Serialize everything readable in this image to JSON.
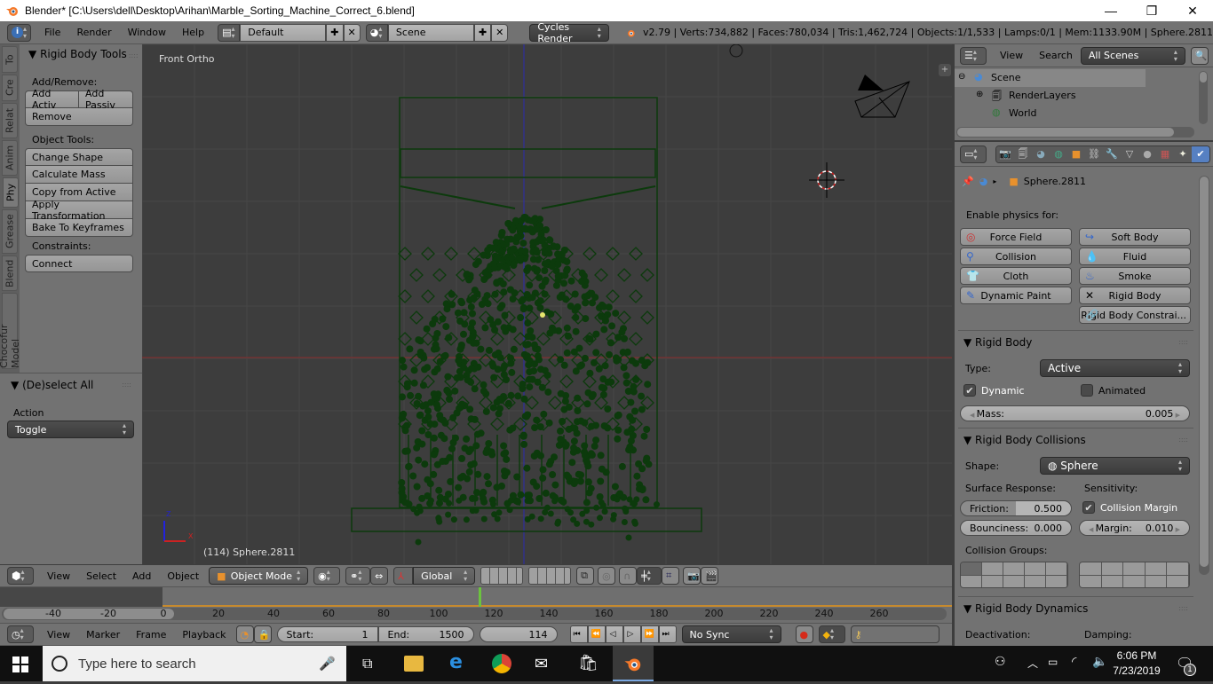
{
  "window": {
    "title": "Blender* [C:\\Users\\dell\\Desktop\\Arihan\\Marble_Sorting_Machine_Correct_6.blend]",
    "controls": [
      "—",
      "❐",
      "✕"
    ]
  },
  "top_header": {
    "menus": [
      "File",
      "Render",
      "Window",
      "Help"
    ],
    "screen_layout": "Default",
    "scene": "Scene",
    "render_engine": "Cycles Render",
    "stats": "v2.79 | Verts:734,882 | Faces:780,034 | Tris:1,462,724 | Objects:1/1,533 | Lamps:0/1 | Mem:1133.90M | Sphere.2811"
  },
  "toolshelf": {
    "tabs": [
      "To",
      "Cre",
      "Relat",
      "Anim",
      "Phy",
      "Grease",
      "Blend",
      "Chocofur Model"
    ],
    "active_tab": "Phy",
    "panel_title": "Rigid Body Tools",
    "add_remove_label": "Add/Remove:",
    "add_active": "Add Activ",
    "add_passive": "Add Passiv",
    "remove": "Remove",
    "object_tools_label": "Object Tools:",
    "object_tools": [
      "Change Shape",
      "Calculate Mass",
      "Copy from Active",
      "Apply Transformation",
      "Bake To Keyframes"
    ],
    "constraints_label": "Constraints:",
    "connect": "Connect",
    "operator_title": "(De)select All",
    "action_label": "Action",
    "action_value": "Toggle"
  },
  "viewport": {
    "view_label": "Front Ortho",
    "object_info": "(114) Sphere.2811",
    "axis_x": "X",
    "axis_z": "Z"
  },
  "viewport_header": {
    "menus": [
      "View",
      "Select",
      "Add",
      "Object"
    ],
    "mode": "Object Mode",
    "orientation": "Global"
  },
  "outliner": {
    "menus": [
      "View",
      "Search"
    ],
    "filter": "All Scenes",
    "items": [
      {
        "label": "Scene",
        "level": 0
      },
      {
        "label": "RenderLayers",
        "level": 1
      },
      {
        "label": "World",
        "level": 1
      }
    ]
  },
  "properties": {
    "breadcrumb_object": "Sphere.2811",
    "enable_physics_label": "Enable physics for:",
    "physics_buttons": [
      {
        "label": "Force Field",
        "icon": "force-field-icon"
      },
      {
        "label": "Soft Body",
        "icon": "soft-body-icon"
      },
      {
        "label": "Collision",
        "icon": "collision-icon"
      },
      {
        "label": "Fluid",
        "icon": "fluid-icon"
      },
      {
        "label": "Cloth",
        "icon": "cloth-icon"
      },
      {
        "label": "Smoke",
        "icon": "smoke-icon"
      },
      {
        "label": "Dynamic Paint",
        "icon": "dynamic-paint-icon"
      },
      {
        "label": "Rigid Body",
        "icon": "close-x-icon"
      },
      {
        "label": "Rigid Body Constrai...",
        "icon": "chain-link-icon"
      }
    ],
    "rigid_body": {
      "title": "Rigid Body",
      "type_label": "Type:",
      "type_value": "Active",
      "dynamic_label": "Dynamic",
      "dynamic_checked": true,
      "animated_label": "Animated",
      "animated_checked": false,
      "mass_label": "Mass:",
      "mass_value": "0.005"
    },
    "collisions": {
      "title": "Rigid Body Collisions",
      "shape_label": "Shape:",
      "shape_value": "Sphere",
      "surface_label": "Surface Response:",
      "sensitivity_label": "Sensitivity:",
      "friction_label": "Friction:",
      "friction_value": "0.500",
      "friction_fraction": 0.5,
      "bounciness_label": "Bounciness:",
      "bounciness_value": "0.000",
      "collision_margin_label": "Collision Margin",
      "collision_margin_checked": true,
      "margin_label": "Margin:",
      "margin_value": "0.010",
      "groups_label": "Collision Groups:",
      "active_group": 0
    },
    "dynamics": {
      "title": "Rigid Body Dynamics",
      "deactivation_label": "Deactivation:",
      "damping_label": "Damping:"
    }
  },
  "timeline": {
    "ticks": [
      "-40",
      "-20",
      "0",
      "20",
      "40",
      "60",
      "80",
      "100",
      "120",
      "140",
      "160",
      "180",
      "200",
      "220",
      "240",
      "260"
    ],
    "current_frame": "114",
    "menus": [
      "View",
      "Marker",
      "Frame",
      "Playback"
    ],
    "start_label": "Start:",
    "start_value": "1",
    "end_label": "End:",
    "end_value": "1500",
    "sync": "No Sync"
  },
  "taskbar": {
    "search_placeholder": "Type here to search",
    "time": "6:06 PM",
    "date": "7/23/2019",
    "notification_count": "1"
  }
}
